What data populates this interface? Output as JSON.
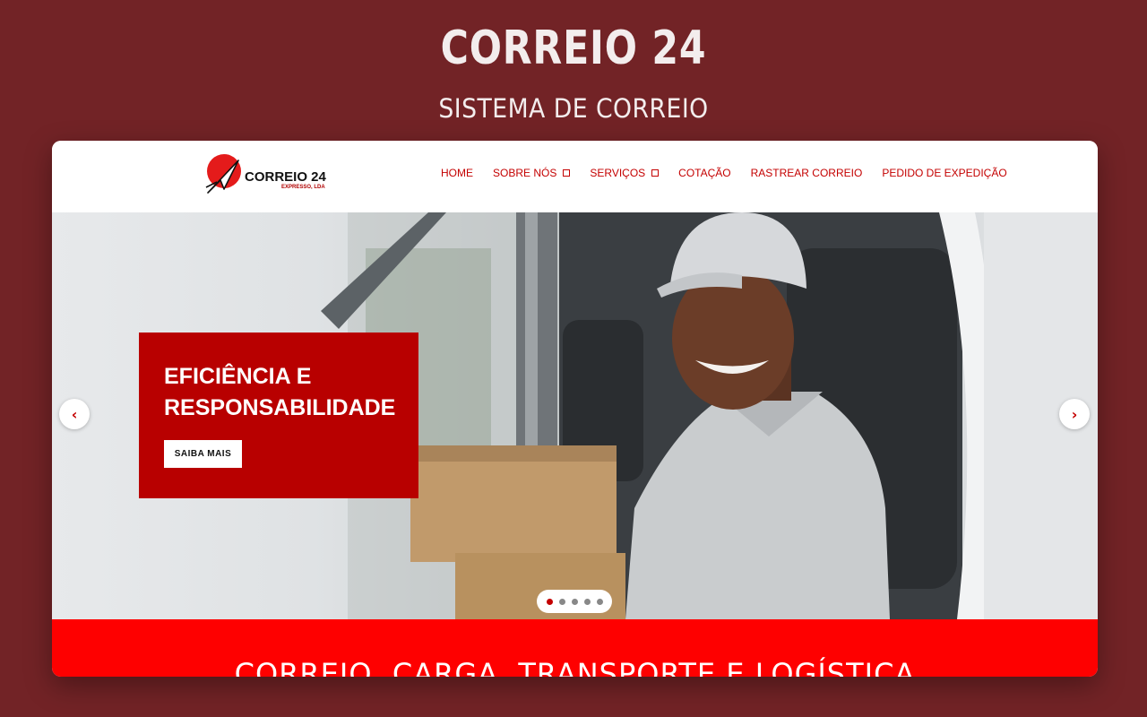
{
  "page": {
    "title": "CORREIO 24",
    "subtitle": "SISTEMA DE CORREIO"
  },
  "site": {
    "logo": {
      "name": "CORREIO 24",
      "tagline": "EXPRESSO, LDA"
    },
    "nav": [
      {
        "label": "HOME",
        "dropdown": false
      },
      {
        "label": "SOBRE NÓS",
        "dropdown": true
      },
      {
        "label": "SERVIÇOS",
        "dropdown": true
      },
      {
        "label": "COTAÇÃO",
        "dropdown": false
      },
      {
        "label": "RASTREAR CORREIO",
        "dropdown": false
      },
      {
        "label": "PEDIDO DE EXPEDIÇÃO",
        "dropdown": false
      }
    ],
    "hero": {
      "caption_title": "EFICIÊNCIA E RESPONSABILIDADE",
      "cta_label": "SAIBA MAIS",
      "prev_icon": "chevron-left-icon",
      "next_icon": "chevron-right-icon",
      "slide_count": 5,
      "active_slide": 1
    },
    "band": {
      "text": "CORREIO, CARGA, TRANSPORTE E LOGÍSTICA"
    }
  },
  "colors": {
    "background": "#722326",
    "brand_red": "#c40000",
    "caption_red": "#b80000",
    "band_red": "#fe0000"
  }
}
